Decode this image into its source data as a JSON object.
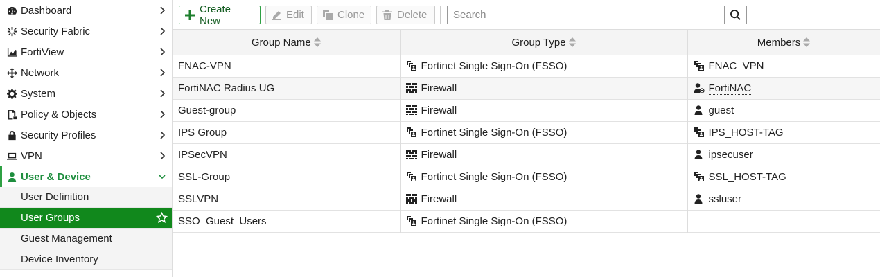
{
  "sidebar": {
    "items": [
      {
        "label": "Dashboard",
        "icon": "dashboard-icon"
      },
      {
        "label": "Security Fabric",
        "icon": "security-fabric-icon"
      },
      {
        "label": "FortiView",
        "icon": "fortiview-icon"
      },
      {
        "label": "Network",
        "icon": "network-icon"
      },
      {
        "label": "System",
        "icon": "gear-icon"
      },
      {
        "label": "Policy & Objects",
        "icon": "policy-icon"
      },
      {
        "label": "Security Profiles",
        "icon": "lock-icon"
      },
      {
        "label": "VPN",
        "icon": "laptop-icon"
      },
      {
        "label": "User & Device",
        "icon": "user-icon"
      }
    ],
    "subitems": [
      {
        "label": "User Definition"
      },
      {
        "label": "User Groups"
      },
      {
        "label": "Guest Management"
      },
      {
        "label": "Device Inventory"
      }
    ],
    "active_color": "#1e8e3e",
    "selected_bg": "#11881c"
  },
  "toolbar": {
    "create_new": "Create New",
    "edit": "Edit",
    "clone": "Clone",
    "delete": "Delete",
    "search_placeholder": "Search"
  },
  "table": {
    "headers": [
      "Group Name",
      "Group Type",
      "Members"
    ],
    "rows": [
      {
        "name": "FNAC-VPN",
        "type": "Fortinet Single Sign-On (FSSO)",
        "type_icon": "fsso-icon",
        "member": "FNAC_VPN",
        "member_icon": "fsso-icon"
      },
      {
        "name": "FortiNAC Radius UG",
        "type": "Firewall",
        "type_icon": "firewall-icon",
        "member": "FortiNAC",
        "member_icon": "radius-user-icon"
      },
      {
        "name": "Guest-group",
        "type": "Firewall",
        "type_icon": "firewall-icon",
        "member": "guest",
        "member_icon": "user-icon"
      },
      {
        "name": "IPS Group",
        "type": "Fortinet Single Sign-On (FSSO)",
        "type_icon": "fsso-icon",
        "member": "IPS_HOST-TAG",
        "member_icon": "fsso-icon"
      },
      {
        "name": "IPSecVPN",
        "type": "Firewall",
        "type_icon": "firewall-icon",
        "member": "ipsecuser",
        "member_icon": "user-icon"
      },
      {
        "name": "SSL-Group",
        "type": "Fortinet Single Sign-On (FSSO)",
        "type_icon": "fsso-icon",
        "member": "SSL_HOST-TAG",
        "member_icon": "fsso-icon"
      },
      {
        "name": "SSLVPN",
        "type": "Firewall",
        "type_icon": "firewall-icon",
        "member": "ssluser",
        "member_icon": "user-icon"
      },
      {
        "name": "SSO_Guest_Users",
        "type": "Fortinet Single Sign-On (FSSO)",
        "type_icon": "fsso-icon",
        "member": "",
        "member_icon": ""
      }
    ]
  }
}
